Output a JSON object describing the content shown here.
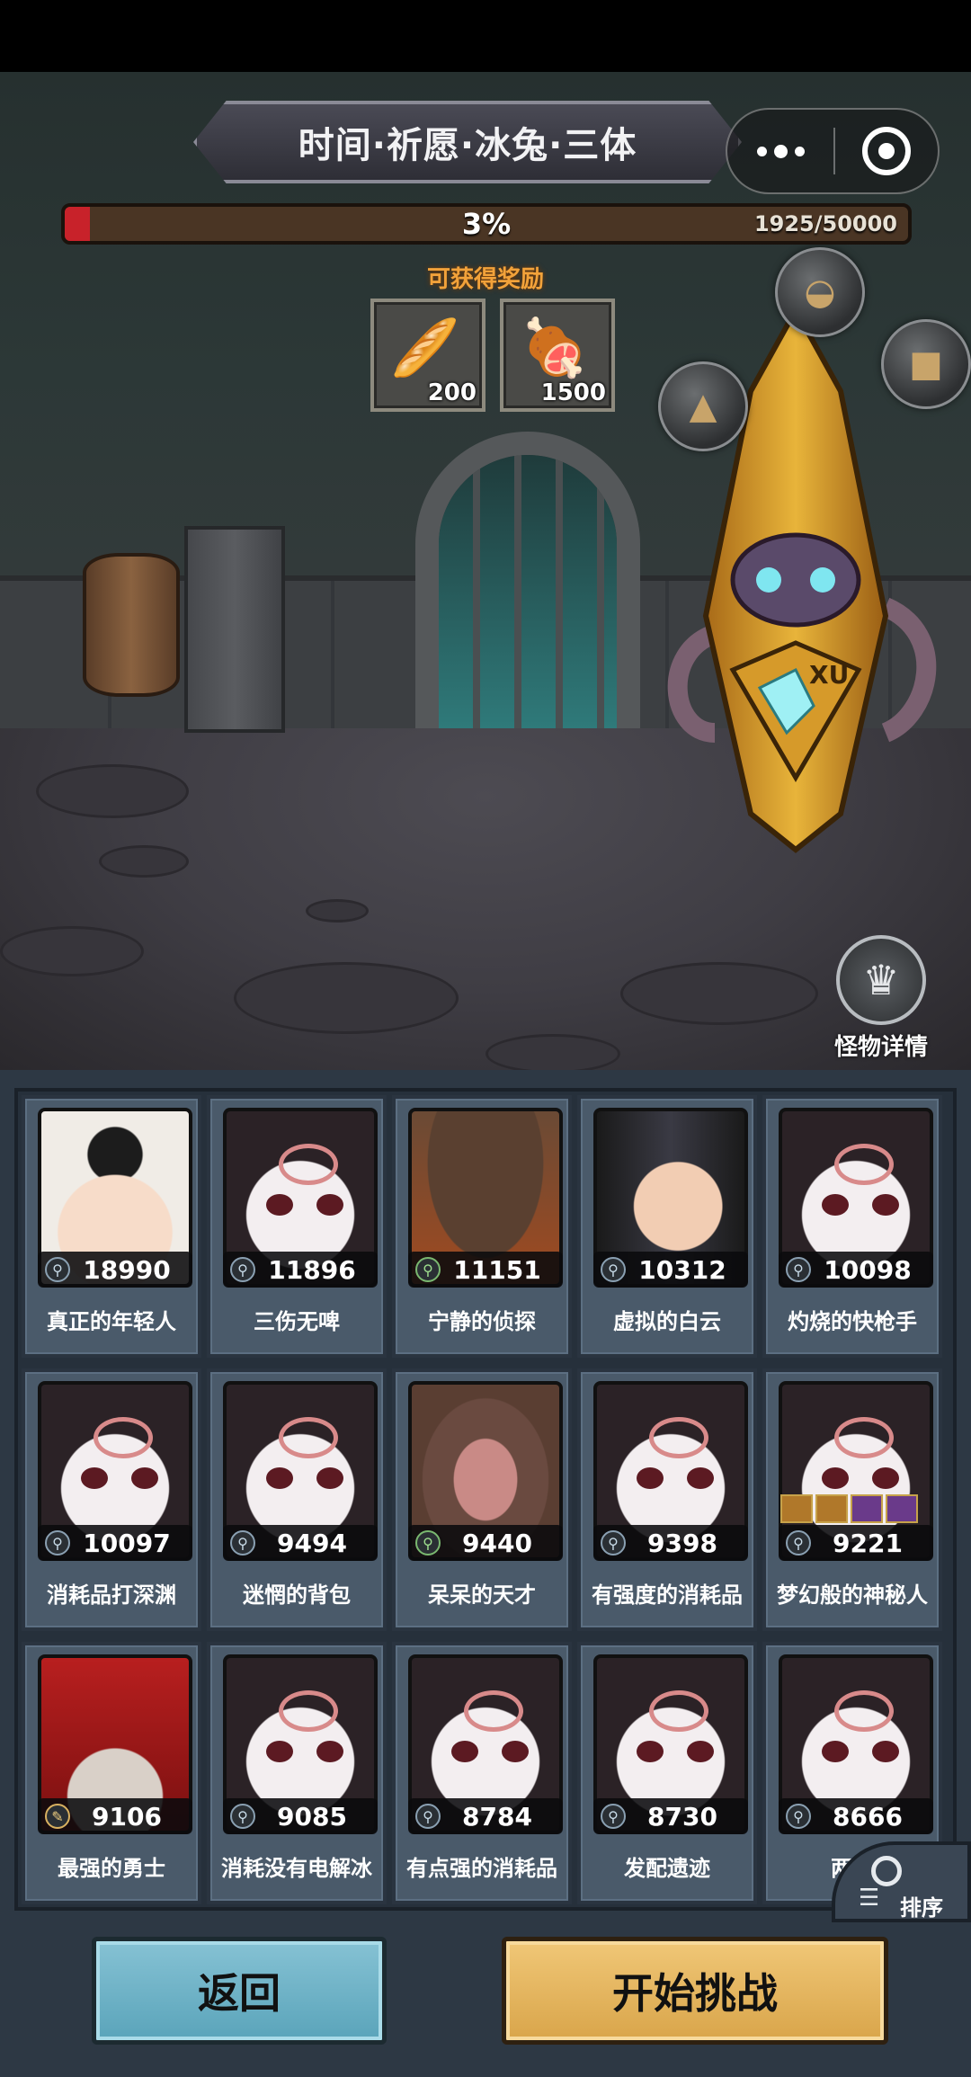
{
  "header": {
    "title": "时间·祈愿·冰兔·三体"
  },
  "capsule": {
    "more_icon": "more-dots-icon",
    "close_icon": "target-ring-icon"
  },
  "progress": {
    "percent_label": "3%",
    "fraction": 0.03,
    "current": "1925",
    "total": "50000",
    "count_label": "1925/50000"
  },
  "rewards": {
    "label": "可获得奖励",
    "items": [
      {
        "icon": "bread-icon",
        "glyph": "🥖",
        "qty": "200"
      },
      {
        "icon": "meat-icon",
        "glyph": "🍖",
        "qty": "1500"
      }
    ]
  },
  "monster_detail": {
    "label": "怪物详情",
    "icon": "monster-crown-icon"
  },
  "heroes": [
    {
      "name": "真正的年轻人",
      "power": "18990",
      "portrait": "girl",
      "stat_icon": "normal"
    },
    {
      "name": "三伤无啤",
      "power": "11896",
      "portrait": "skull",
      "stat_icon": "normal"
    },
    {
      "name": "宁静的侦探",
      "power": "11151",
      "portrait": "cowboy",
      "stat_icon": "green"
    },
    {
      "name": "虚拟的白云",
      "power": "10312",
      "portrait": "man",
      "stat_icon": "normal"
    },
    {
      "name": "灼烧的快枪手",
      "power": "10098",
      "portrait": "skull",
      "stat_icon": "normal"
    },
    {
      "name": "消耗品打深渊",
      "power": "10097",
      "portrait": "skull",
      "stat_icon": "normal"
    },
    {
      "name": "迷惘的背包",
      "power": "9494",
      "portrait": "skull",
      "stat_icon": "normal"
    },
    {
      "name": "呆呆的天才",
      "power": "9440",
      "portrait": "hippo",
      "stat_icon": "green"
    },
    {
      "name": "有强度的消耗品",
      "power": "9398",
      "portrait": "skull",
      "stat_icon": "normal"
    },
    {
      "name": "梦幻般的神秘人",
      "power": "9221",
      "portrait": "skull",
      "stat_icon": "normal",
      "equip": true
    },
    {
      "name": "最强的勇士",
      "power": "9106",
      "portrait": "red",
      "stat_icon": "gold"
    },
    {
      "name": "消耗没有电解冰",
      "power": "9085",
      "portrait": "skull",
      "stat_icon": "normal"
    },
    {
      "name": "有点强的消耗品",
      "power": "8784",
      "portrait": "skull",
      "stat_icon": "normal"
    },
    {
      "name": "发配遗迹",
      "power": "8730",
      "portrait": "skull",
      "stat_icon": "normal"
    },
    {
      "name": "两年",
      "power": "8666",
      "portrait": "skull",
      "stat_icon": "normal"
    }
  ],
  "sort": {
    "label": "排序",
    "icon": "search-list-icon"
  },
  "buttons": {
    "back": "返回",
    "start": "开始挑战"
  }
}
